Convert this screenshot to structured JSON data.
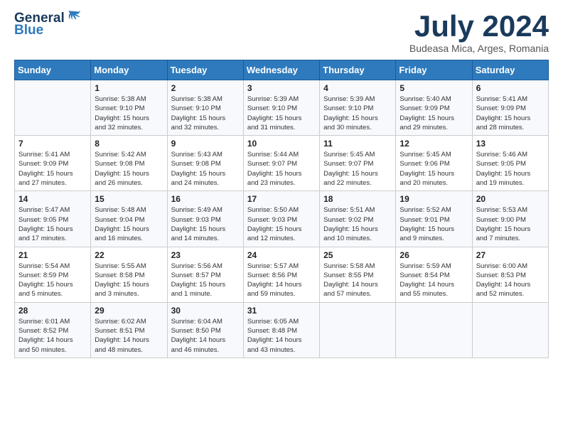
{
  "logo": {
    "general": "General",
    "blue": "Blue"
  },
  "title": "July 2024",
  "location": "Budeasa Mica, Arges, Romania",
  "days_of_week": [
    "Sunday",
    "Monday",
    "Tuesday",
    "Wednesday",
    "Thursday",
    "Friday",
    "Saturday"
  ],
  "weeks": [
    [
      {
        "day": "",
        "info": ""
      },
      {
        "day": "1",
        "info": "Sunrise: 5:38 AM\nSunset: 9:10 PM\nDaylight: 15 hours\nand 32 minutes."
      },
      {
        "day": "2",
        "info": "Sunrise: 5:38 AM\nSunset: 9:10 PM\nDaylight: 15 hours\nand 32 minutes."
      },
      {
        "day": "3",
        "info": "Sunrise: 5:39 AM\nSunset: 9:10 PM\nDaylight: 15 hours\nand 31 minutes."
      },
      {
        "day": "4",
        "info": "Sunrise: 5:39 AM\nSunset: 9:10 PM\nDaylight: 15 hours\nand 30 minutes."
      },
      {
        "day": "5",
        "info": "Sunrise: 5:40 AM\nSunset: 9:09 PM\nDaylight: 15 hours\nand 29 minutes."
      },
      {
        "day": "6",
        "info": "Sunrise: 5:41 AM\nSunset: 9:09 PM\nDaylight: 15 hours\nand 28 minutes."
      }
    ],
    [
      {
        "day": "7",
        "info": "Sunrise: 5:41 AM\nSunset: 9:09 PM\nDaylight: 15 hours\nand 27 minutes."
      },
      {
        "day": "8",
        "info": "Sunrise: 5:42 AM\nSunset: 9:08 PM\nDaylight: 15 hours\nand 26 minutes."
      },
      {
        "day": "9",
        "info": "Sunrise: 5:43 AM\nSunset: 9:08 PM\nDaylight: 15 hours\nand 24 minutes."
      },
      {
        "day": "10",
        "info": "Sunrise: 5:44 AM\nSunset: 9:07 PM\nDaylight: 15 hours\nand 23 minutes."
      },
      {
        "day": "11",
        "info": "Sunrise: 5:45 AM\nSunset: 9:07 PM\nDaylight: 15 hours\nand 22 minutes."
      },
      {
        "day": "12",
        "info": "Sunrise: 5:45 AM\nSunset: 9:06 PM\nDaylight: 15 hours\nand 20 minutes."
      },
      {
        "day": "13",
        "info": "Sunrise: 5:46 AM\nSunset: 9:05 PM\nDaylight: 15 hours\nand 19 minutes."
      }
    ],
    [
      {
        "day": "14",
        "info": "Sunrise: 5:47 AM\nSunset: 9:05 PM\nDaylight: 15 hours\nand 17 minutes."
      },
      {
        "day": "15",
        "info": "Sunrise: 5:48 AM\nSunset: 9:04 PM\nDaylight: 15 hours\nand 16 minutes."
      },
      {
        "day": "16",
        "info": "Sunrise: 5:49 AM\nSunset: 9:03 PM\nDaylight: 15 hours\nand 14 minutes."
      },
      {
        "day": "17",
        "info": "Sunrise: 5:50 AM\nSunset: 9:03 PM\nDaylight: 15 hours\nand 12 minutes."
      },
      {
        "day": "18",
        "info": "Sunrise: 5:51 AM\nSunset: 9:02 PM\nDaylight: 15 hours\nand 10 minutes."
      },
      {
        "day": "19",
        "info": "Sunrise: 5:52 AM\nSunset: 9:01 PM\nDaylight: 15 hours\nand 9 minutes."
      },
      {
        "day": "20",
        "info": "Sunrise: 5:53 AM\nSunset: 9:00 PM\nDaylight: 15 hours\nand 7 minutes."
      }
    ],
    [
      {
        "day": "21",
        "info": "Sunrise: 5:54 AM\nSunset: 8:59 PM\nDaylight: 15 hours\nand 5 minutes."
      },
      {
        "day": "22",
        "info": "Sunrise: 5:55 AM\nSunset: 8:58 PM\nDaylight: 15 hours\nand 3 minutes."
      },
      {
        "day": "23",
        "info": "Sunrise: 5:56 AM\nSunset: 8:57 PM\nDaylight: 15 hours\nand 1 minute."
      },
      {
        "day": "24",
        "info": "Sunrise: 5:57 AM\nSunset: 8:56 PM\nDaylight: 14 hours\nand 59 minutes."
      },
      {
        "day": "25",
        "info": "Sunrise: 5:58 AM\nSunset: 8:55 PM\nDaylight: 14 hours\nand 57 minutes."
      },
      {
        "day": "26",
        "info": "Sunrise: 5:59 AM\nSunset: 8:54 PM\nDaylight: 14 hours\nand 55 minutes."
      },
      {
        "day": "27",
        "info": "Sunrise: 6:00 AM\nSunset: 8:53 PM\nDaylight: 14 hours\nand 52 minutes."
      }
    ],
    [
      {
        "day": "28",
        "info": "Sunrise: 6:01 AM\nSunset: 8:52 PM\nDaylight: 14 hours\nand 50 minutes."
      },
      {
        "day": "29",
        "info": "Sunrise: 6:02 AM\nSunset: 8:51 PM\nDaylight: 14 hours\nand 48 minutes."
      },
      {
        "day": "30",
        "info": "Sunrise: 6:04 AM\nSunset: 8:50 PM\nDaylight: 14 hours\nand 46 minutes."
      },
      {
        "day": "31",
        "info": "Sunrise: 6:05 AM\nSunset: 8:48 PM\nDaylight: 14 hours\nand 43 minutes."
      },
      {
        "day": "",
        "info": ""
      },
      {
        "day": "",
        "info": ""
      },
      {
        "day": "",
        "info": ""
      }
    ]
  ]
}
